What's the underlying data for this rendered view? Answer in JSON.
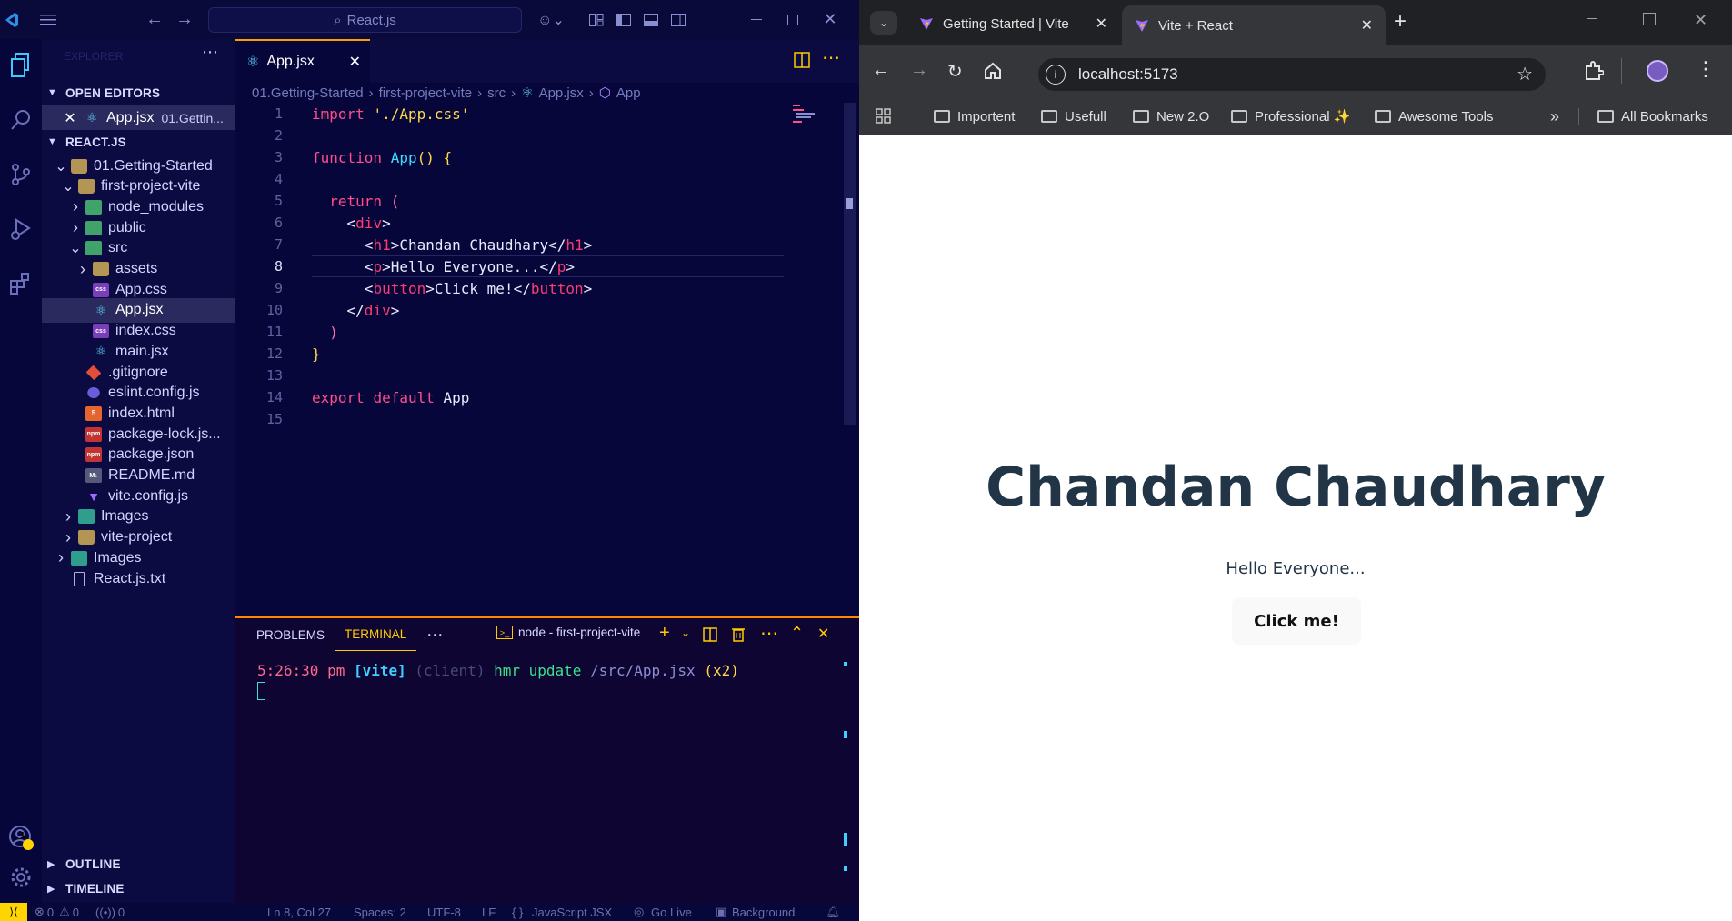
{
  "vscode": {
    "search_text": "React.js",
    "sidebar": {
      "explorer_label": "EXPLORER",
      "open_editors_label": "OPEN EDITORS",
      "open_editor": {
        "name": "App.jsx",
        "path": "01.Gettin..."
      },
      "workspace_label": "REACT.JS",
      "tree": [
        {
          "label": "01.Getting-Started",
          "type": "folder"
        },
        {
          "label": "first-project-vite",
          "type": "folder"
        },
        {
          "label": "node_modules",
          "type": "folder-node"
        },
        {
          "label": "public",
          "type": "folder-public"
        },
        {
          "label": "src",
          "type": "folder-src"
        },
        {
          "label": "assets",
          "type": "folder-assets"
        },
        {
          "label": "App.css",
          "type": "css"
        },
        {
          "label": "App.jsx",
          "type": "react"
        },
        {
          "label": "index.css",
          "type": "css"
        },
        {
          "label": "main.jsx",
          "type": "react"
        },
        {
          "label": ".gitignore",
          "type": "git"
        },
        {
          "label": "eslint.config.js",
          "type": "eslint"
        },
        {
          "label": "index.html",
          "type": "html"
        },
        {
          "label": "package-lock.js...",
          "type": "npm"
        },
        {
          "label": "package.json",
          "type": "npm"
        },
        {
          "label": "README.md",
          "type": "md"
        },
        {
          "label": "vite.config.js",
          "type": "vite"
        },
        {
          "label": "Images",
          "type": "folder-images"
        },
        {
          "label": "vite-project",
          "type": "folder"
        },
        {
          "label": "Images",
          "type": "folder-images"
        },
        {
          "label": "React.js.txt",
          "type": "txt"
        }
      ],
      "outline_label": "OUTLINE",
      "timeline_label": "TIMELINE",
      "accounts_badge": "1"
    },
    "editor": {
      "tab_label": "App.jsx",
      "breadcrumb": [
        "01.Getting-Started",
        "first-project-vite",
        "src",
        "App.jsx",
        "App"
      ],
      "line_numbers": [
        "1",
        "2",
        "3",
        "4",
        "5",
        "6",
        "7",
        "8",
        "9",
        "10",
        "11",
        "12",
        "13",
        "14",
        "15"
      ],
      "current_line": "8"
    },
    "panel": {
      "tabs": [
        "PROBLEMS",
        "TERMINAL"
      ],
      "active_tab": "TERMINAL",
      "terminal_name": "node - first-project-vite",
      "log_time": "5:26:30 pm",
      "log_tag": "[vite]",
      "log_client": "(client)",
      "log_msg": "hmr update",
      "log_path": "/src/App.jsx",
      "log_count": "(x2)"
    },
    "status": {
      "errors": "0",
      "warnings": "0",
      "ports": "0",
      "position": "Ln 8, Col 27",
      "spaces": "Spaces: 2",
      "encoding": "UTF-8",
      "eol": "LF",
      "language": "JavaScript JSX",
      "go_live": "Go Live",
      "background": "Background"
    }
  },
  "chrome": {
    "tabs": [
      {
        "title": "Getting Started | Vite",
        "active": false
      },
      {
        "title": "Vite + React",
        "active": true
      }
    ],
    "url": "localhost:5173",
    "bookmarks": [
      "Importent",
      "Usefull",
      "New 2.O",
      "Professional ✨",
      "Awesome Tools"
    ],
    "all_bookmarks": "All Bookmarks",
    "page": {
      "heading": "Chandan Chaudhary",
      "paragraph": "Hello Everyone...",
      "button": "Click me!"
    }
  },
  "colors": {
    "vscode_bg": "#06063a",
    "accent_orange": "#ff9d00",
    "keyword": "#ffb000",
    "tag": "#ff3c72",
    "page_text": "#213547"
  }
}
